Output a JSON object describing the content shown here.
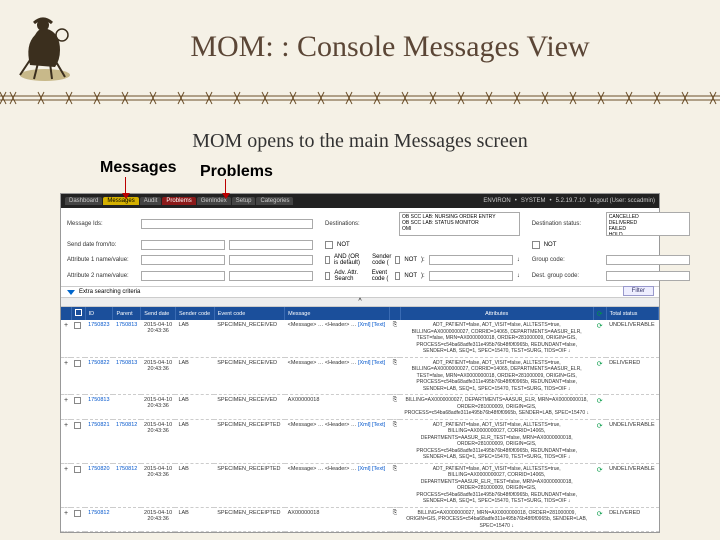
{
  "slide": {
    "title": "MOM: : Console Messages View",
    "subtitle": "MOM opens to the main Messages screen",
    "callout_messages": "Messages",
    "callout_problems": "Problems"
  },
  "tabs": {
    "items": [
      "Dashboard",
      "Messages",
      "Audit",
      "Problems",
      "GenIndex",
      "Setup",
      "Categories"
    ],
    "right": {
      "environ": "ENVIRON",
      "system": "SYSTEM",
      "ver": "5.2.19.7.10",
      "logout": "Logout (User: sccadmin)"
    }
  },
  "filter": {
    "msgids_label": "Message Ids:",
    "senddate_label": "Send date from/to:",
    "attr1_label": "Attribute 1 name/value:",
    "attr2_label": "Attribute 2 name/value:",
    "dest_label": "Destinations:",
    "dest_options": "OB SCC LAB: NURSING ORDER ENTRY\nOB SCC LAB: STATUS MONITOR\nOMI",
    "dest_status_label": "Destination status:",
    "dest_status_options": "CANCELLED\nDELIVERED\nFAILED\nHOLD",
    "not": "NOT",
    "and_or": "AND (OR is default)",
    "sender_label": "Sender code (",
    "adv_attr": "Adv. Attr. Search",
    "event_label": "Event code (",
    "group_label": "Group code:",
    "destgroup_label": "Dest. group code:",
    "extra": "Extra searching criteria",
    "filter_btn": "Filter",
    "collapse": "^"
  },
  "grid": {
    "headers": [
      "",
      "",
      "ID",
      "Parent",
      "Send date",
      "Sender code",
      "Event code",
      "Message",
      "",
      "Attributes",
      "",
      "Total status"
    ],
    "rows": [
      {
        "id": "1750823",
        "parent": "1750813",
        "date": "2015-04-10 20:43:36",
        "sender": "LAB",
        "event": "SPECIMEN_RECEIVED",
        "msg": "<Message> … <Header> … [Xml] [Text]",
        "attr": "ADT_PATIENT=false, ADT_VISIT=false, ALLTESTS=true, BILLING=AX0000000027, CORRID=14065, DEPARTMENTS=AASUR_ELR, TEST=false, MRN=AX0000000018, ORDER=281000009, ORIGIN=GIS, PROCESS=c54ba68adfe311e495b76b48f0f0965b, REDUNDANT=false, SENDER=LAB, SEQ=1, SPEC=15470, TEST=SURG, TIDS=OIF ↓",
        "status": "UNDELIVERABLE"
      },
      {
        "id": "1750822",
        "parent": "1750813",
        "date": "2015-04-10 20:43:36",
        "sender": "LAB",
        "event": "SPECIMEN_RECEIVED",
        "msg": "<Message> … <Header> … [Xml] [Text]",
        "attr": "ADT_PATIENT=false, ADT_VISIT=false, ALLTESTS=true, BILLING=AX0000000027, CORRID=14065, DEPARTMENTS=AASUR_ELR, TEST=false, MRN=AX0000000018, ORDER=281000009, ORIGIN=GIS, PROCESS=c54ba68adfe311e495b76b48f0f0965b, REDUNDANT=false, SENDER=LAB, SEQ=1, SPEC=15470, TEST=SURG, TIDS=OIF ↓",
        "status": "DELIVERED"
      },
      {
        "id": "1750813",
        "parent": "",
        "date": "2015-04-10 20:43:36",
        "sender": "LAB",
        "event": "SPECIMEN_RECEIVED",
        "msg": "AX00000018",
        "attr": "BILLING=AX0000000027, DEPARTMENTS=AASUR_ELR, MRN=AX0000000018, ORDER=281000009, ORIGIN=GIS, PROCESS=c54ba68adfe311e495b76b48f0f0965b, SENDER=LAB, SPEC=15470 ↓",
        "status": ""
      },
      {
        "id": "1750821",
        "parent": "1750812",
        "date": "2015-04-10 20:43:36",
        "sender": "LAB",
        "event": "SPECIMEN_RECEIPTED",
        "msg": "<Message> … <Header> … [Xml] [Text]",
        "attr": "ADT_PATIENT=false, ADT_VISIT=false, ALLTESTS=true, BILLING=AX0000000027, CORRID=14065, DEPARTMENTS=AASUR_ELR_TEST=false, MRN=AX0000000018, ORDER=281000009, ORIGIN=GIS, PROCESS=c54ba68adfe311e495b76b48f0f0965b, REDUNDANT=false, SENDER=LAB, SEQ=1, SPEC=15470, TEST=SURG, TIDS=OIF ↓",
        "status": "UNDELIVERABLE"
      },
      {
        "id": "1750820",
        "parent": "1750812",
        "date": "2015-04-10 20:43:36",
        "sender": "LAB",
        "event": "SPECIMEN_RECEIPTED",
        "msg": "<Message> … <Header> … [Xml] [Text]",
        "attr": "ADT_PATIENT=false, ADT_VISIT=false, ALLTESTS=true, BILLING=AX0000000027, CORRID=14065, DEPARTMENTS=AASUR_ELR_TEST=false, MRN=AX0000000018, ORDER=281000009, ORIGIN=GIS, PROCESS=c54ba68adfe311e495b76b48f0f0965b, REDUNDANT=false, SENDER=LAB, SEQ=1, SPEC=15470, TEST=SURG, TIDS=OIF ↓",
        "status": "UNDELIVERABLE"
      },
      {
        "id": "1750812",
        "parent": "",
        "date": "2015-04-10 20:43:36",
        "sender": "LAB",
        "event": "SPECIMEN_RECEIPTED",
        "msg": "AX00000018",
        "attr": "BILLING=AX0000000027, MRN=AX0000000018, ORDER=281000009, ORIGIN=GIS, PROCESS=c54ba68adfe311e495b76b48f0f0965b, SENDER=LAB, SPEC=15470 ↓",
        "status": "DELIVERED"
      }
    ]
  }
}
